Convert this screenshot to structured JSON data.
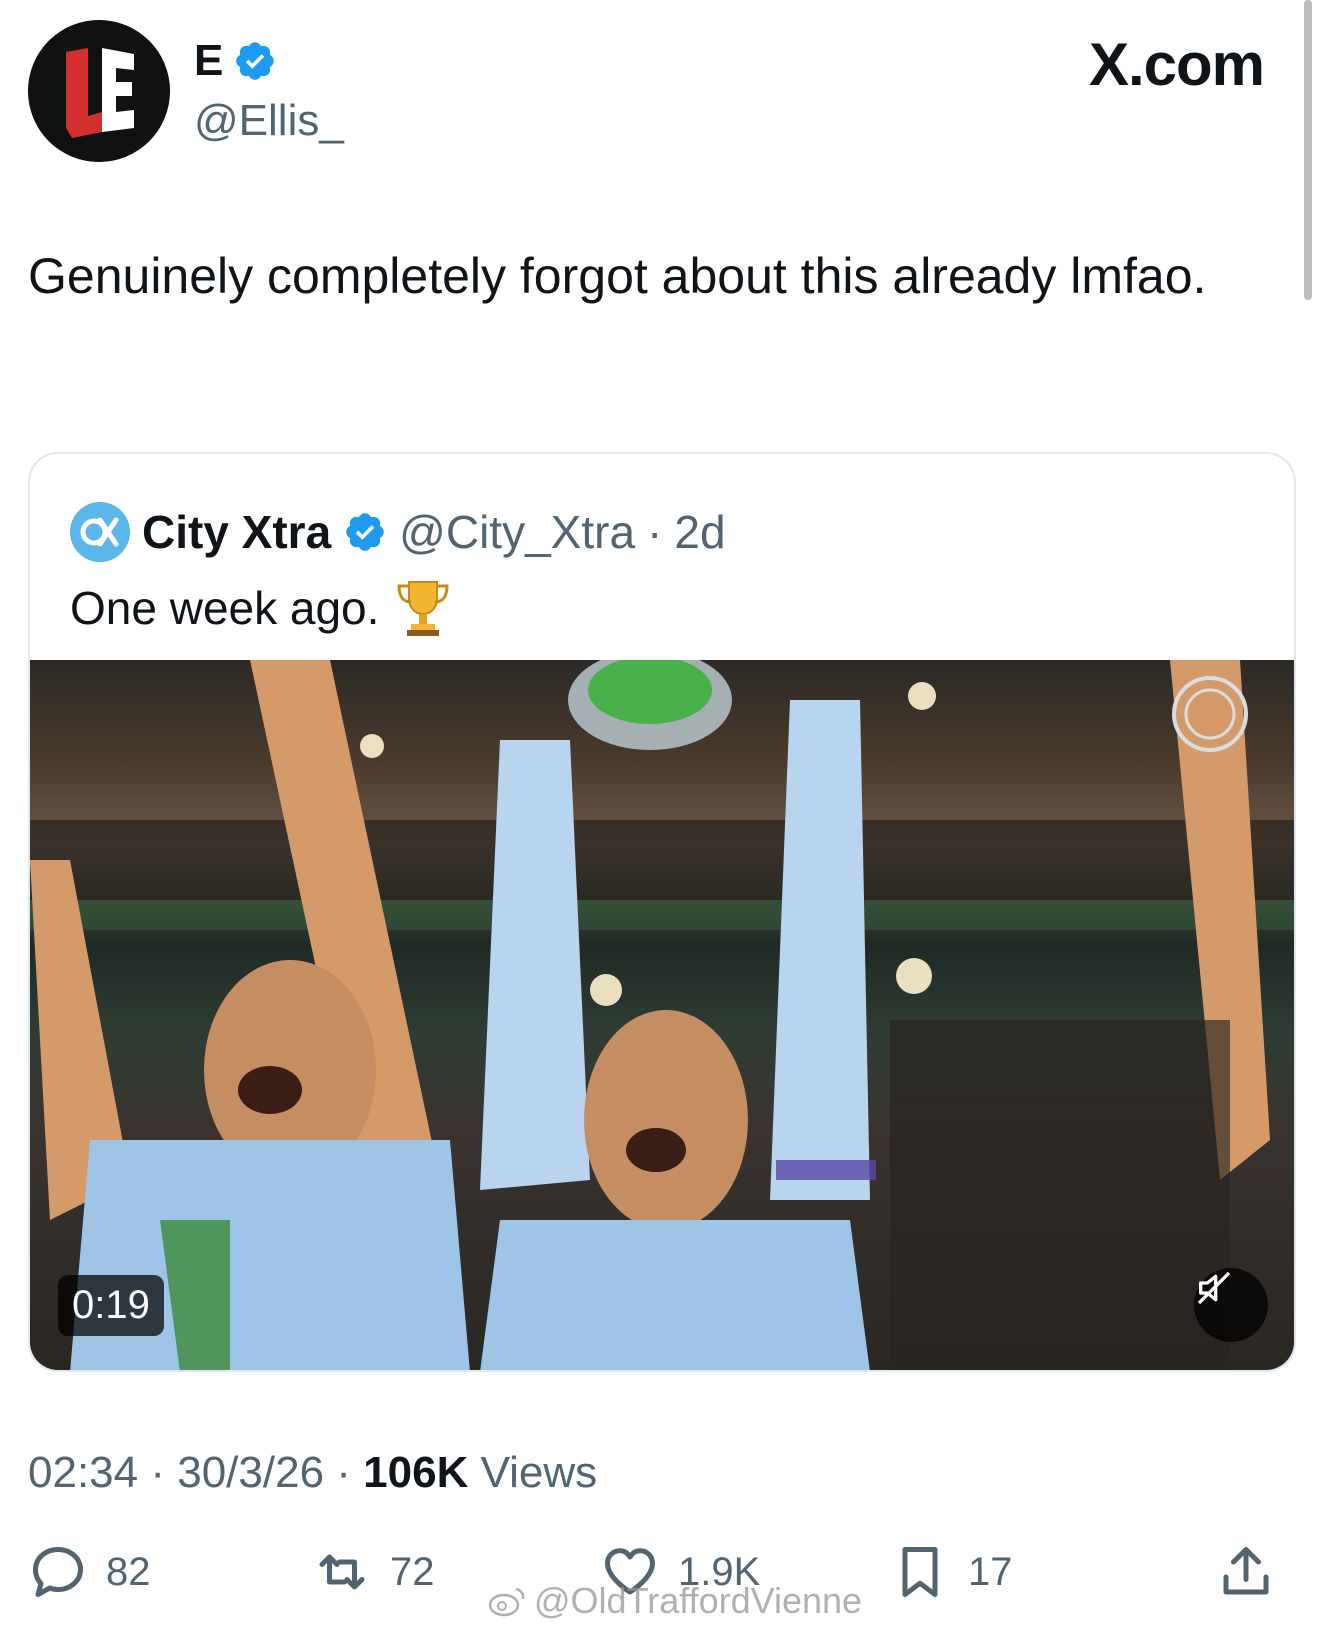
{
  "header": {
    "display_name": "E",
    "handle": "@Ellis_",
    "brand": "X.com",
    "avatar_icon": "ue-logo"
  },
  "tweet": {
    "text": "Genuinely completely forgot about this already lmfao."
  },
  "quote": {
    "name": "City Xtra",
    "handle": "@City_Xtra",
    "separator": "·",
    "time": "2d",
    "text": "One week ago.",
    "emoji_icon": "trophy-icon",
    "video": {
      "duration": "0:19",
      "mute_icon": "muted-speaker-icon"
    }
  },
  "meta": {
    "time": "02:34",
    "dot1": "·",
    "date": "30/3/26",
    "dot2": "·",
    "views_count": "106K",
    "views_label": "Views"
  },
  "actions": {
    "replies": "82",
    "reposts": "72",
    "likes": "1.9K",
    "bookmarks": "17"
  },
  "watermark": {
    "text": "@OldTraffordVienne"
  },
  "colors": {
    "text": "#0f1419",
    "secondary": "#536471",
    "verified": "#1d9bf0",
    "border": "#e1e8ed"
  }
}
